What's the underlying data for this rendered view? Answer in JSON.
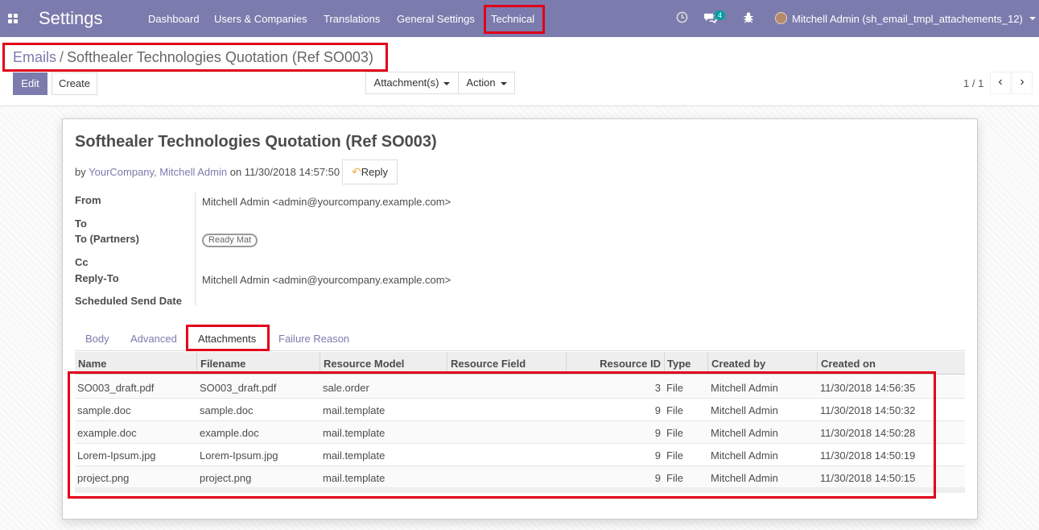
{
  "navbar": {
    "brand": "Settings",
    "menu": [
      "Dashboard",
      "Users & Companies",
      "Translations",
      "General Settings",
      "Technical"
    ],
    "chat_badge": "4",
    "user": "Mitchell Admin (sh_email_tmpl_attachements_12)",
    "icons": [
      "apps-icon",
      "clock-icon",
      "chat-icon",
      "bug-icon"
    ]
  },
  "breadcrumb": {
    "parent": "Emails",
    "separator": "/",
    "current": "Softhealer Technologies Quotation (Ref SO003)"
  },
  "buttons": {
    "edit": "Edit",
    "create": "Create",
    "attachments": "Attachment(s)",
    "action": "Action"
  },
  "pager": {
    "value": "1 / 1"
  },
  "email": {
    "subject": "Softhealer Technologies Quotation (Ref SO003)",
    "by_prefix": "by",
    "authors": "YourCompany, Mitchell Admin",
    "date_text": "on 11/30/2018 14:57:50",
    "reply_label": "Reply"
  },
  "fields": {
    "from_label": "From",
    "from_value": "Mitchell Admin <admin@yourcompany.example.com>",
    "to_label": "To",
    "to_partners_label": "To (Partners)",
    "to_partners_tag": "Ready Mat",
    "cc_label": "Cc",
    "reply_to_label": "Reply-To",
    "reply_to_value": "Mitchell Admin <admin@yourcompany.example.com>",
    "scheduled_label": "Scheduled Send Date"
  },
  "tabs": [
    "Body",
    "Advanced",
    "Attachments",
    "Failure Reason"
  ],
  "table": {
    "headers": [
      "Name",
      "Filename",
      "Resource Model",
      "Resource Field",
      "Resource ID",
      "Type",
      "Created by",
      "Created on"
    ],
    "rows": [
      [
        "SO003_draft.pdf",
        "SO003_draft.pdf",
        "sale.order",
        "",
        "3",
        "File",
        "Mitchell Admin",
        "11/30/2018 14:56:35"
      ],
      [
        "sample.doc",
        "sample.doc",
        "mail.template",
        "",
        "9",
        "File",
        "Mitchell Admin",
        "11/30/2018 14:50:32"
      ],
      [
        "example.doc",
        "example.doc",
        "mail.template",
        "",
        "9",
        "File",
        "Mitchell Admin",
        "11/30/2018 14:50:28"
      ],
      [
        "Lorem-Ipsum.jpg",
        "Lorem-Ipsum.jpg",
        "mail.template",
        "",
        "9",
        "File",
        "Mitchell Admin",
        "11/30/2018 14:50:19"
      ],
      [
        "project.png",
        "project.png",
        "mail.template",
        "",
        "9",
        "File",
        "Mitchell Admin",
        "11/30/2018 14:50:15"
      ]
    ]
  },
  "colors": {
    "brand": "#7c7bad",
    "highlight": "#e0001a"
  }
}
